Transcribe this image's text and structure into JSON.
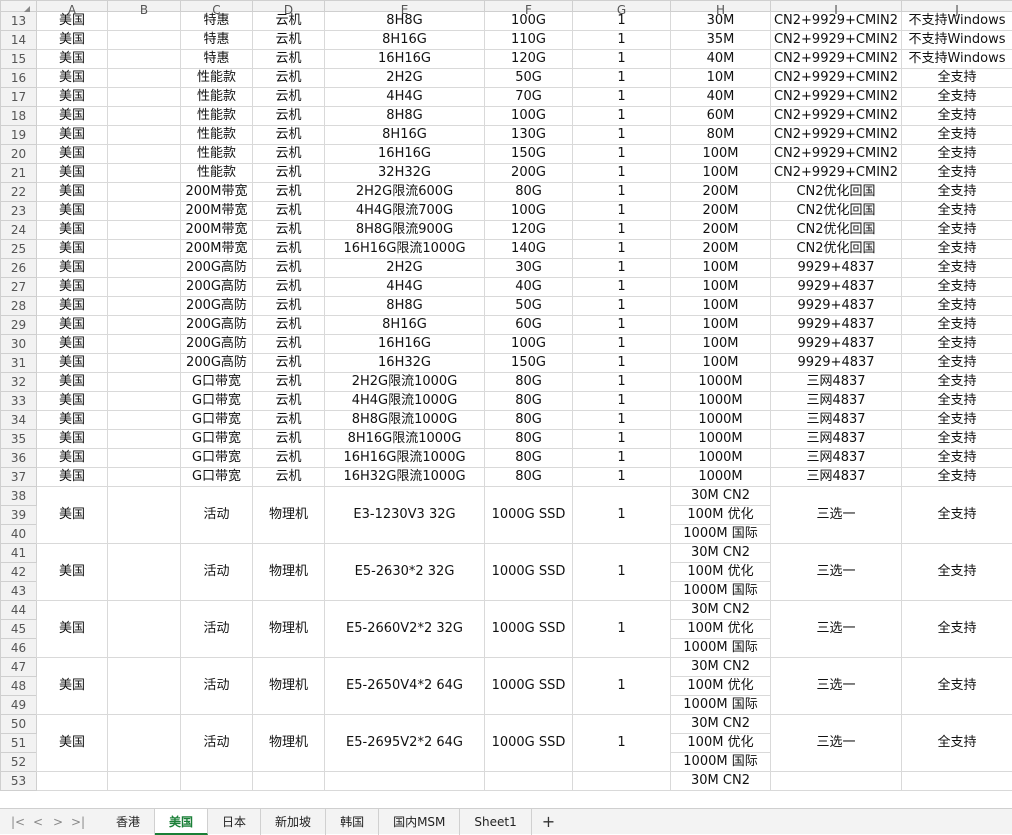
{
  "columns": [
    "A",
    "B",
    "C",
    "D",
    "E",
    "F",
    "G",
    "H",
    "I",
    "J"
  ],
  "rows": [
    {
      "n": "13",
      "cells": [
        "美国",
        "",
        "特惠",
        "云机",
        "8H8G",
        "100G",
        "1",
        "30M",
        "CN2+9929+CMIN2",
        "不支持Windows"
      ]
    },
    {
      "n": "14",
      "cells": [
        "美国",
        "",
        "特惠",
        "云机",
        "8H16G",
        "110G",
        "1",
        "35M",
        "CN2+9929+CMIN2",
        "不支持Windows"
      ]
    },
    {
      "n": "15",
      "cells": [
        "美国",
        "",
        "特惠",
        "云机",
        "16H16G",
        "120G",
        "1",
        "40M",
        "CN2+9929+CMIN2",
        "不支持Windows"
      ]
    },
    {
      "n": "16",
      "cells": [
        "美国",
        "",
        "性能款",
        "云机",
        "2H2G",
        "50G",
        "1",
        "10M",
        "CN2+9929+CMIN2",
        "全支持"
      ]
    },
    {
      "n": "17",
      "cells": [
        "美国",
        "",
        "性能款",
        "云机",
        "4H4G",
        "70G",
        "1",
        "40M",
        "CN2+9929+CMIN2",
        "全支持"
      ]
    },
    {
      "n": "18",
      "cells": [
        "美国",
        "",
        "性能款",
        "云机",
        "8H8G",
        "100G",
        "1",
        "60M",
        "CN2+9929+CMIN2",
        "全支持"
      ]
    },
    {
      "n": "19",
      "cells": [
        "美国",
        "",
        "性能款",
        "云机",
        "8H16G",
        "130G",
        "1",
        "80M",
        "CN2+9929+CMIN2",
        "全支持"
      ]
    },
    {
      "n": "20",
      "cells": [
        "美国",
        "",
        "性能款",
        "云机",
        "16H16G",
        "150G",
        "1",
        "100M",
        "CN2+9929+CMIN2",
        "全支持"
      ]
    },
    {
      "n": "21",
      "cells": [
        "美国",
        "",
        "性能款",
        "云机",
        "32H32G",
        "200G",
        "1",
        "100M",
        "CN2+9929+CMIN2",
        "全支持"
      ]
    },
    {
      "n": "22",
      "cells": [
        "美国",
        "",
        "200M带宽",
        "云机",
        "2H2G限流600G",
        "80G",
        "1",
        "200M",
        "CN2优化回国",
        "全支持"
      ]
    },
    {
      "n": "23",
      "cells": [
        "美国",
        "",
        "200M带宽",
        "云机",
        "4H4G限流700G",
        "100G",
        "1",
        "200M",
        "CN2优化回国",
        "全支持"
      ]
    },
    {
      "n": "24",
      "cells": [
        "美国",
        "",
        "200M带宽",
        "云机",
        "8H8G限流900G",
        "120G",
        "1",
        "200M",
        "CN2优化回国",
        "全支持"
      ]
    },
    {
      "n": "25",
      "cells": [
        "美国",
        "",
        "200M带宽",
        "云机",
        "16H16G限流1000G",
        "140G",
        "1",
        "200M",
        "CN2优化回国",
        "全支持"
      ]
    },
    {
      "n": "26",
      "cells": [
        "美国",
        "",
        "200G高防",
        "云机",
        "2H2G",
        "30G",
        "1",
        "100M",
        "9929+4837",
        "全支持"
      ]
    },
    {
      "n": "27",
      "cells": [
        "美国",
        "",
        "200G高防",
        "云机",
        "4H4G",
        "40G",
        "1",
        "100M",
        "9929+4837",
        "全支持"
      ]
    },
    {
      "n": "28",
      "cells": [
        "美国",
        "",
        "200G高防",
        "云机",
        "8H8G",
        "50G",
        "1",
        "100M",
        "9929+4837",
        "全支持"
      ]
    },
    {
      "n": "29",
      "cells": [
        "美国",
        "",
        "200G高防",
        "云机",
        "8H16G",
        "60G",
        "1",
        "100M",
        "9929+4837",
        "全支持"
      ]
    },
    {
      "n": "30",
      "cells": [
        "美国",
        "",
        "200G高防",
        "云机",
        "16H16G",
        "100G",
        "1",
        "100M",
        "9929+4837",
        "全支持"
      ]
    },
    {
      "n": "31",
      "cells": [
        "美国",
        "",
        "200G高防",
        "云机",
        "16H32G",
        "150G",
        "1",
        "100M",
        "9929+4837",
        "全支持"
      ]
    },
    {
      "n": "32",
      "cells": [
        "美国",
        "",
        "G口带宽",
        "云机",
        "2H2G限流1000G",
        "80G",
        "1",
        "1000M",
        "三网4837",
        "全支持"
      ]
    },
    {
      "n": "33",
      "cells": [
        "美国",
        "",
        "G口带宽",
        "云机",
        "4H4G限流1000G",
        "80G",
        "1",
        "1000M",
        "三网4837",
        "全支持"
      ]
    },
    {
      "n": "34",
      "cells": [
        "美国",
        "",
        "G口带宽",
        "云机",
        "8H8G限流1000G",
        "80G",
        "1",
        "1000M",
        "三网4837",
        "全支持"
      ]
    },
    {
      "n": "35",
      "cells": [
        "美国",
        "",
        "G口带宽",
        "云机",
        "8H16G限流1000G",
        "80G",
        "1",
        "1000M",
        "三网4837",
        "全支持"
      ]
    },
    {
      "n": "36",
      "cells": [
        "美国",
        "",
        "G口带宽",
        "云机",
        "16H16G限流1000G",
        "80G",
        "1",
        "1000M",
        "三网4837",
        "全支持"
      ]
    },
    {
      "n": "37",
      "cells": [
        "美国",
        "",
        "G口带宽",
        "云机",
        "16H32G限流1000G",
        "80G",
        "1",
        "1000M",
        "三网4837",
        "全支持"
      ]
    }
  ],
  "groups": [
    {
      "rows": [
        "38",
        "39",
        "40"
      ],
      "country": "美国",
      "b": "",
      "type": "活动",
      "machine": "物理机",
      "cpu": "E3-1230V3 32G",
      "disk": "1000G SSD",
      "qty": "1",
      "bw": [
        "30M CN2",
        "100M 优化",
        "1000M 国际"
      ],
      "line": "三选一",
      "os": "全支持"
    },
    {
      "rows": [
        "41",
        "42",
        "43"
      ],
      "country": "美国",
      "b": "",
      "type": "活动",
      "machine": "物理机",
      "cpu": "E5-2630*2 32G",
      "disk": "1000G SSD",
      "qty": "1",
      "bw": [
        "30M CN2",
        "100M 优化",
        "1000M 国际"
      ],
      "line": "三选一",
      "os": "全支持"
    },
    {
      "rows": [
        "44",
        "45",
        "46"
      ],
      "country": "美国",
      "b": "",
      "type": "活动",
      "machine": "物理机",
      "cpu": "E5-2660V2*2 32G",
      "disk": "1000G SSD",
      "qty": "1",
      "bw": [
        "30M CN2",
        "100M 优化",
        "1000M 国际"
      ],
      "line": "三选一",
      "os": "全支持"
    },
    {
      "rows": [
        "47",
        "48",
        "49"
      ],
      "country": "美国",
      "b": "",
      "type": "活动",
      "machine": "物理机",
      "cpu": "E5-2650V4*2 64G",
      "disk": "1000G SSD",
      "qty": "1",
      "bw": [
        "30M CN2",
        "100M 优化",
        "1000M 国际"
      ],
      "line": "三选一",
      "os": "全支持"
    },
    {
      "rows": [
        "50",
        "51",
        "52"
      ],
      "country": "美国",
      "b": "",
      "type": "活动",
      "machine": "物理机",
      "cpu": "E5-2695V2*2 64G",
      "disk": "1000G SSD",
      "qty": "1",
      "bw": [
        "30M CN2",
        "100M 优化",
        "1000M 国际"
      ],
      "line": "三选一",
      "os": "全支持"
    }
  ],
  "last_row": {
    "n": "53",
    "h": "30M CN2"
  },
  "tabs": [
    {
      "label": "香港",
      "active": false
    },
    {
      "label": "美国",
      "active": true
    },
    {
      "label": "日本",
      "active": false
    },
    {
      "label": "新加坡",
      "active": false
    },
    {
      "label": "韩国",
      "active": false
    },
    {
      "label": "国内MSM",
      "active": false
    },
    {
      "label": "Sheet1",
      "active": false
    }
  ],
  "nav": {
    "first": "|<",
    "prev": "<",
    "next": ">",
    "last": ">|",
    "add": "+"
  },
  "colors": {
    "active_tab": "#1a7f37",
    "header_bg": "#f2f2f2"
  }
}
